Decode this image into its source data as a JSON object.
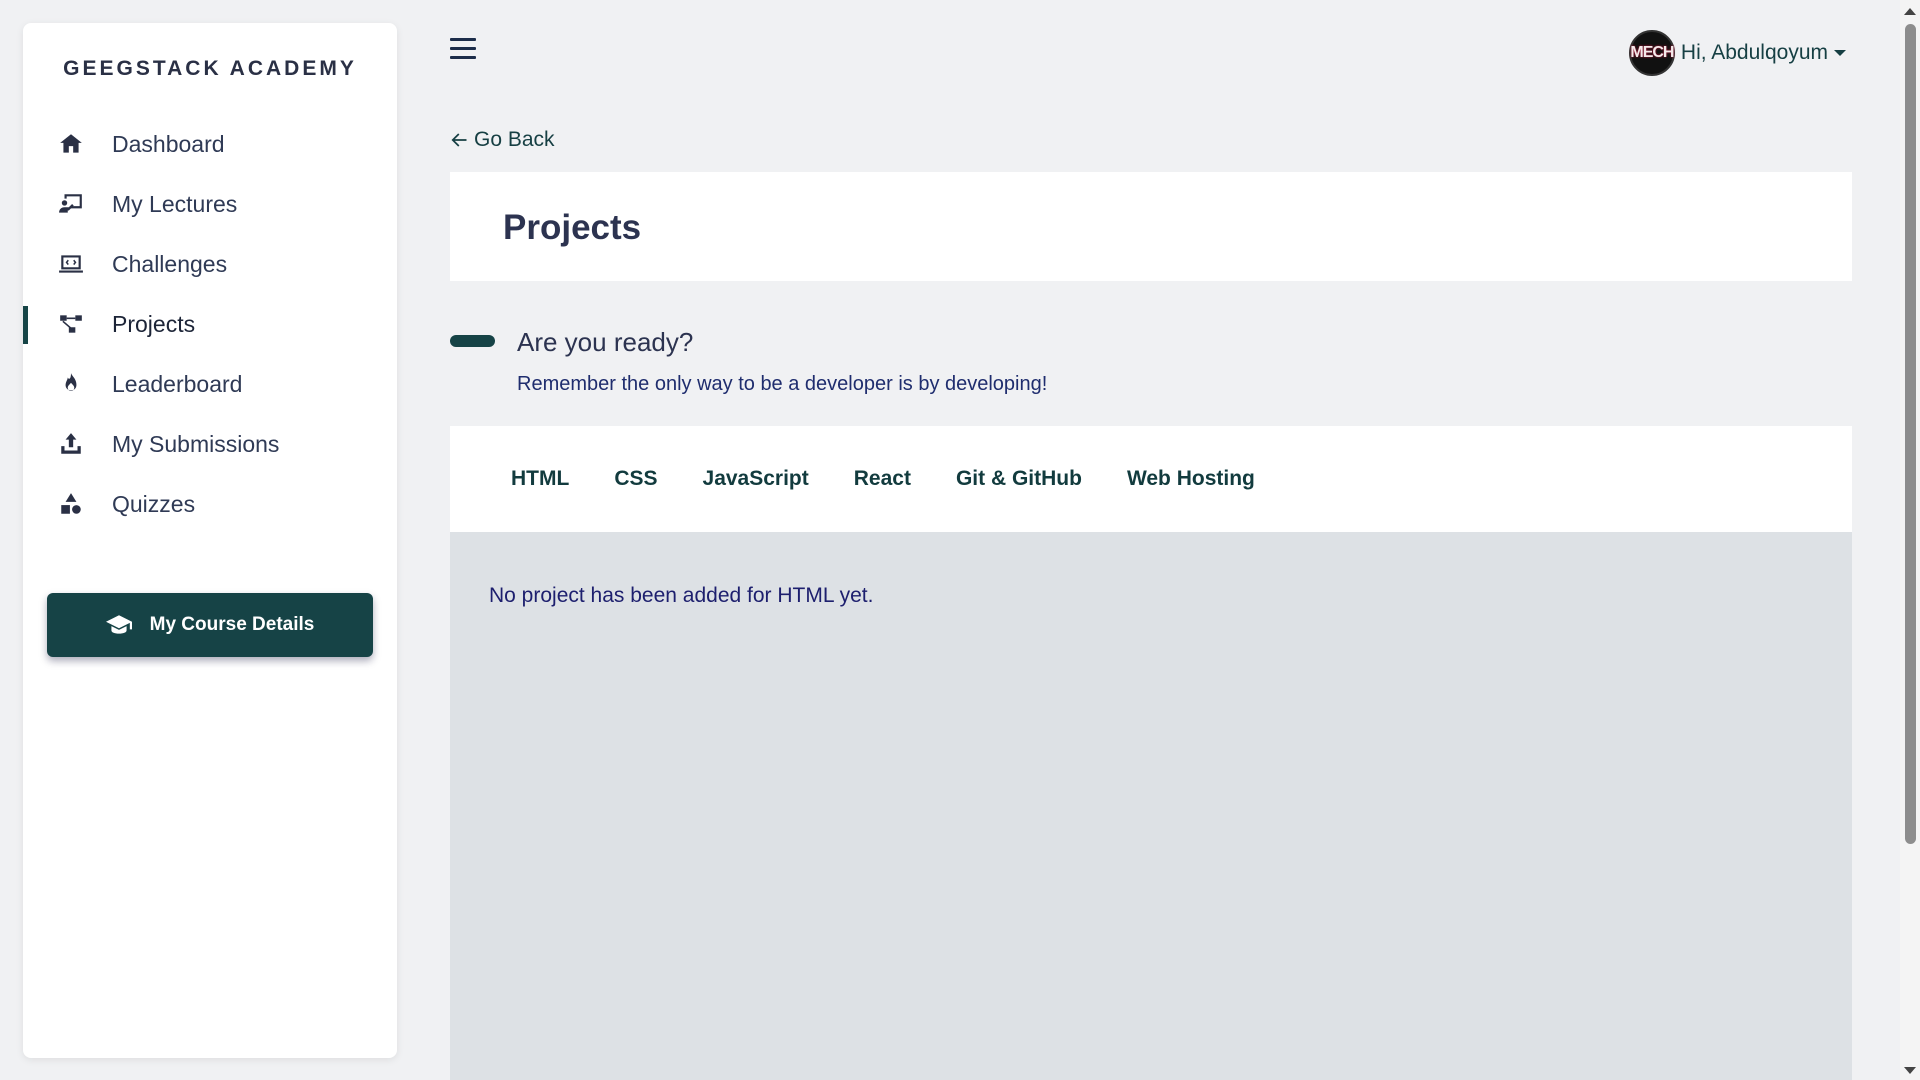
{
  "sidebar": {
    "brand": "GEEGSTACK ACADEMY",
    "items": [
      {
        "label": "Dashboard",
        "icon": "home-icon"
      },
      {
        "label": "My Lectures",
        "icon": "lecture-icon"
      },
      {
        "label": "Challenges",
        "icon": "challenge-icon"
      },
      {
        "label": "Projects",
        "icon": "project-icon",
        "active": true
      },
      {
        "label": "Leaderboard",
        "icon": "fire-icon"
      },
      {
        "label": "My Submissions",
        "icon": "upload-icon"
      },
      {
        "label": "Quizzes",
        "icon": "shapes-icon"
      }
    ],
    "course_button": "My Course Details"
  },
  "header": {
    "avatar_text": "MECH",
    "greeting": "Hi, Abdulqoyum"
  },
  "main": {
    "go_back": "Go Back",
    "title": "Projects",
    "ready_title": "Are you ready?",
    "ready_subtitle": "Remember the only way to be a developer is by developing!",
    "tabs": [
      "HTML",
      "CSS",
      "JavaScript",
      "React",
      "Git & GitHub",
      "Web Hosting"
    ],
    "selected_tab": "HTML",
    "empty_message": "No project has been added for HTML yet."
  },
  "colors": {
    "accent": "#164346",
    "background": "#f0f1f3",
    "panel": "#dde1e5"
  }
}
